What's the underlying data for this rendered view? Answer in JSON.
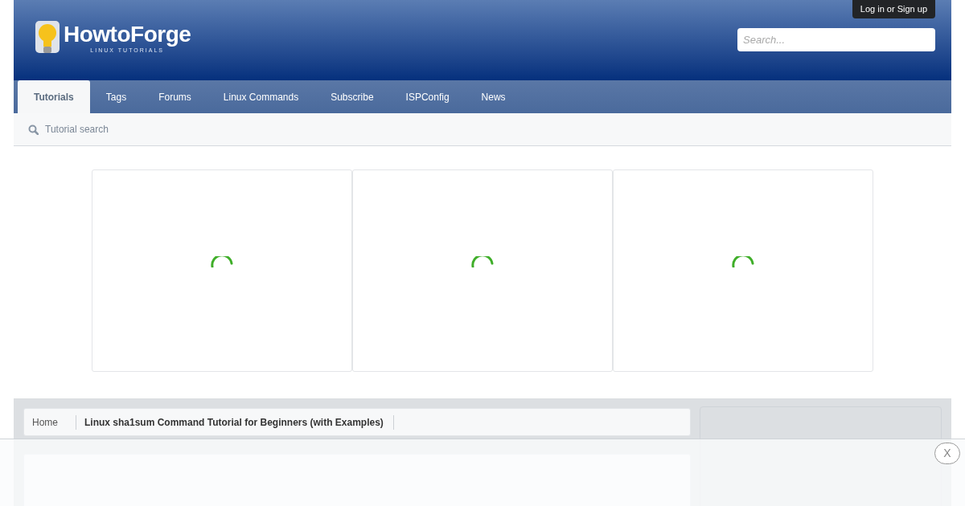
{
  "logo": {
    "name": "HowtoForge",
    "tagline": "LINUX TUTORIALS"
  },
  "login": "Log in or Sign up",
  "search": {
    "placeholder": "Search..."
  },
  "tabs": [
    {
      "label": "Tutorials",
      "selected": true
    },
    {
      "label": "Tags",
      "selected": false
    },
    {
      "label": "Forums",
      "selected": false
    },
    {
      "label": "Linux Commands",
      "selected": false
    },
    {
      "label": "Subscribe",
      "selected": false
    },
    {
      "label": "ISPConfig",
      "selected": false
    },
    {
      "label": "News",
      "selected": false
    }
  ],
  "subnav": {
    "label": "Tutorial search"
  },
  "breadcrumb": [
    "Home",
    "Linux sha1sum Command Tutorial for Beginners (with Examples)"
  ],
  "sticky_bar": {
    "close": "X"
  }
}
